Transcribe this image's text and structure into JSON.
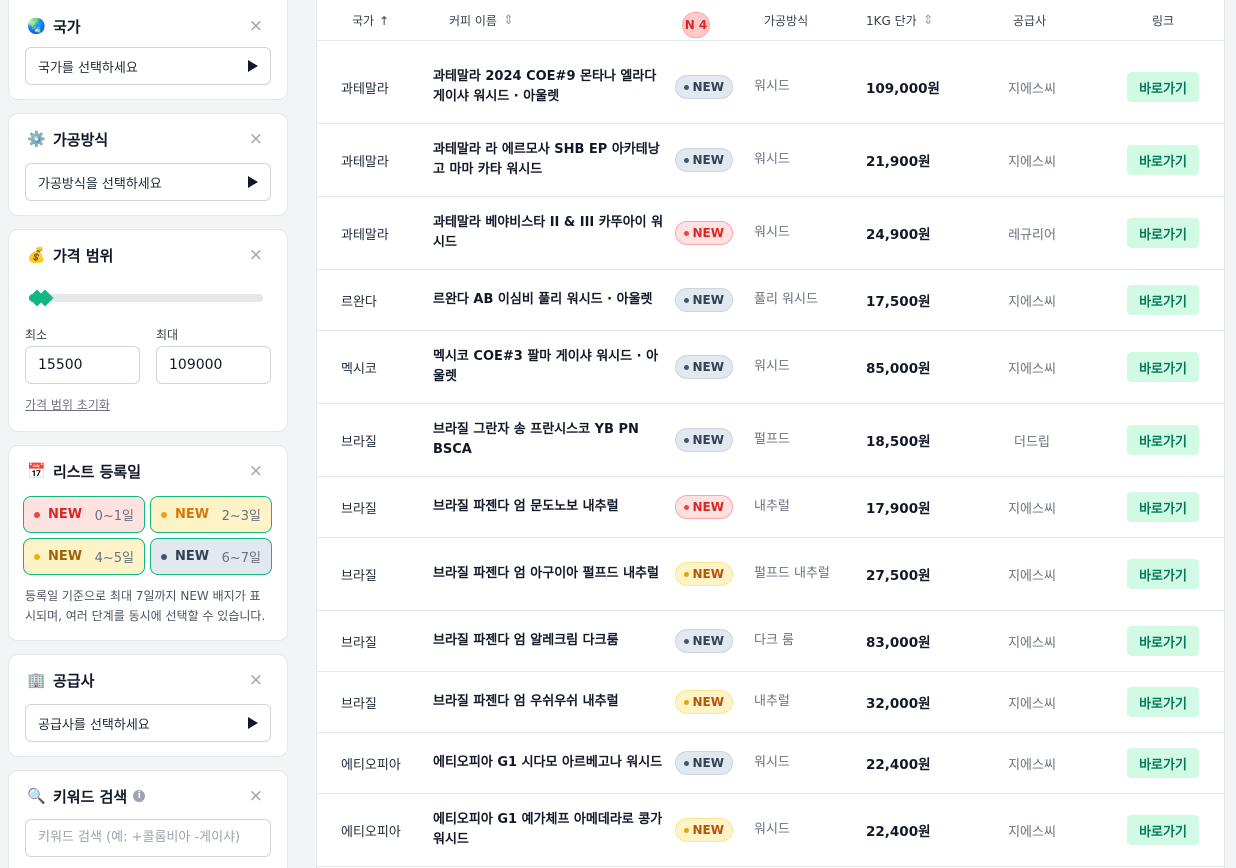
{
  "filters": {
    "country": {
      "icon": "globe-icon",
      "title": "국가",
      "placeholder": "국가를 선택하세요"
    },
    "process": {
      "icon": "gear-icon",
      "title": "가공방식",
      "placeholder": "가공방식을 선택하세요"
    },
    "price": {
      "icon": "money-bag-icon",
      "title": "가격 범위",
      "min_label": "최소",
      "max_label": "최대",
      "min_value": "15500",
      "max_value": "109000",
      "reset": "가격 범위 초기화"
    },
    "date": {
      "icon": "calendar-icon",
      "title": "리스트 등록일",
      "chips": [
        {
          "tag": "NEW",
          "days": "0~1일"
        },
        {
          "tag": "NEW",
          "days": "2~3일"
        },
        {
          "tag": "NEW",
          "days": "4~5일"
        },
        {
          "tag": "NEW",
          "days": "6~7일"
        }
      ],
      "note": "등록일 기준으로 최대 7일까지 NEW 배지가 표시되며, 여러 단계를 동시에 선택할 수 있습니다."
    },
    "supplier": {
      "icon": "building-icon",
      "title": "공급사",
      "placeholder": "공급사를 선택하세요"
    },
    "keyword": {
      "icon": "magnifier-icon",
      "title": "키워드 검색",
      "placeholder": "키워드 검색 (예: +콜롬비아 -게이샤)"
    },
    "close_glyph": "×"
  },
  "table": {
    "headers": {
      "country": "국가",
      "name": "커피 이름",
      "new_count": "N 4",
      "process": "가공방식",
      "price": "1KG 단가",
      "supplier": "공급사",
      "link": "링크"
    },
    "rows": [
      {
        "country": "과테말라",
        "name": "과테말라 2024 COE#9 몬타나 엘라다 게이샤 워시드 · 아울렛",
        "badge": "NEW",
        "level": "gray",
        "process": "워시드",
        "price": "109,000원",
        "supplier": "지에스씨",
        "link": "바로가기"
      },
      {
        "country": "과테말라",
        "name": "과테말라 라 에르모사 SHB EP 아카테낭고 마마 카타 워시드",
        "badge": "NEW",
        "level": "gray",
        "process": "워시드",
        "price": "21,900원",
        "supplier": "지에스씨",
        "link": "바로가기"
      },
      {
        "country": "과테말라",
        "name": "과테말라 베야비스타 II & III 카뚜아이 워시드",
        "badge": "NEW",
        "level": "red",
        "process": "워시드",
        "price": "24,900원",
        "supplier": "레규리어",
        "link": "바로가기"
      },
      {
        "country": "르완다",
        "name": "르완다 AB 이심비 풀리 워시드 · 아울렛",
        "badge": "NEW",
        "level": "gray",
        "process": "풀리 워시드",
        "price": "17,500원",
        "supplier": "지에스씨",
        "link": "바로가기"
      },
      {
        "country": "멕시코",
        "name": "멕시코 COE#3 팔마 게이샤 워시드 · 아울렛",
        "badge": "NEW",
        "level": "gray",
        "process": "워시드",
        "price": "85,000원",
        "supplier": "지에스씨",
        "link": "바로가기"
      },
      {
        "country": "브라질",
        "name": "브라질 그란자 송 프란시스코 YB PN BSCA",
        "badge": "NEW",
        "level": "gray",
        "process": "펄프드",
        "price": "18,500원",
        "supplier": "더드립",
        "link": "바로가기"
      },
      {
        "country": "브라질",
        "name": "브라질 파젠다 엄 문도노보 내추럴",
        "badge": "NEW",
        "level": "red",
        "process": "내추럴",
        "price": "17,900원",
        "supplier": "지에스씨",
        "link": "바로가기"
      },
      {
        "country": "브라질",
        "name": "브라질 파젠다 엄 아구이아 펄프드 내추럴",
        "badge": "NEW",
        "level": "yellow",
        "process": "펄프드 내추럴",
        "price": "27,500원",
        "supplier": "지에스씨",
        "link": "바로가기"
      },
      {
        "country": "브라질",
        "name": "브라질 파젠다 엄 알레크림 다크룸",
        "badge": "NEW",
        "level": "gray",
        "process": "다크 룸",
        "price": "83,000원",
        "supplier": "지에스씨",
        "link": "바로가기"
      },
      {
        "country": "브라질",
        "name": "브라질 파젠다 엄 우쉬우쉬 내추럴",
        "badge": "NEW",
        "level": "yellow",
        "process": "내추럴",
        "price": "32,000원",
        "supplier": "지에스씨",
        "link": "바로가기"
      },
      {
        "country": "에티오피아",
        "name": "에티오피아 G1 시다모 아르베고나 워시드",
        "badge": "NEW",
        "level": "gray",
        "process": "워시드",
        "price": "22,400원",
        "supplier": "지에스씨",
        "link": "바로가기"
      },
      {
        "country": "에티오피아",
        "name": "에티오피아 G1 예가체프 아메데라로 콩가 워시드",
        "badge": "NEW",
        "level": "yellow",
        "process": "워시드",
        "price": "22,400원",
        "supplier": "지에스씨",
        "link": "바로가기"
      }
    ]
  }
}
